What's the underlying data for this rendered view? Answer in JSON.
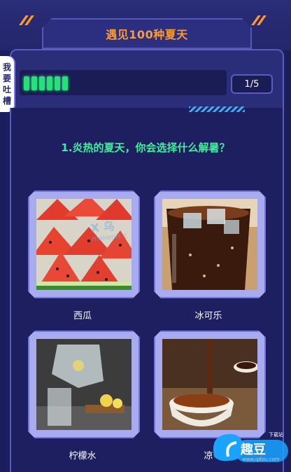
{
  "header": {
    "title": "遇见100种夏天"
  },
  "side_tab": {
    "chars": [
      "我",
      "要",
      "吐",
      "槽"
    ]
  },
  "progress": {
    "current": 1,
    "total": 5,
    "label": "1/5",
    "filled_segments": 6
  },
  "question": {
    "text": "1.炎热的夏天，你会选择什么解暑？"
  },
  "options": [
    {
      "label": "西瓜"
    },
    {
      "label": "冰可乐"
    },
    {
      "label": "柠檬水"
    },
    {
      "label": "凉"
    }
  ],
  "watermark": {
    "text": "X 乌",
    "sub": "malienis.c"
  },
  "logo": {
    "text": "趣豆",
    "small": "下载站",
    "url": "www.qdou.com"
  },
  "colors": {
    "accent": "#ff9a2e",
    "question": "#3ef09a",
    "progress": "#27e07a",
    "bg": "#1b1e5c"
  }
}
